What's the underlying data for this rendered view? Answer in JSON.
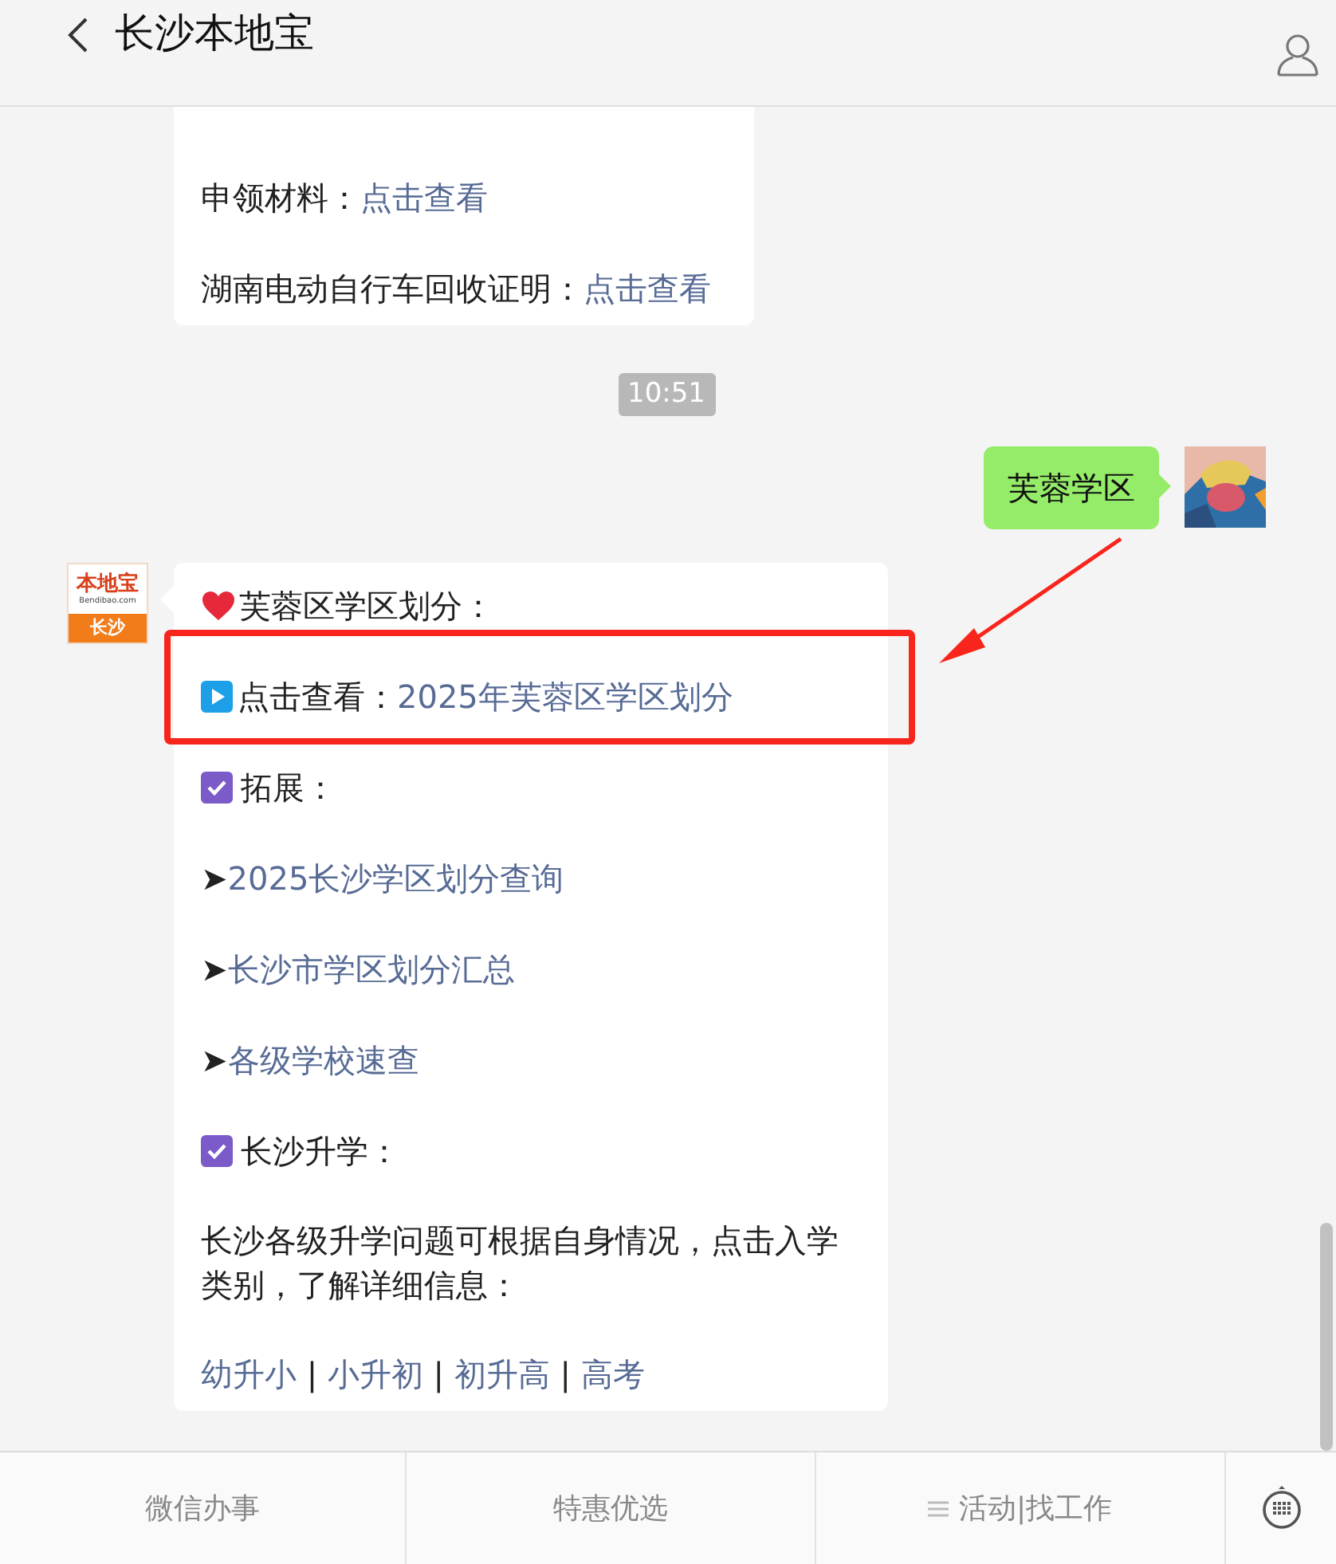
{
  "header": {
    "title": "长沙本地宝"
  },
  "messages": [
    {
      "kind": "bot_card",
      "lines": [
        {
          "kind": "plain",
          "parts": [
            {
              "text": "申领材料：",
              "link": false
            },
            {
              "text": "点击查看",
              "link": true
            }
          ]
        },
        {
          "kind": "plain",
          "parts": [
            {
              "text": "湖南电动自行车回收证明：",
              "link": false
            },
            {
              "text": "点击查看",
              "link": true
            }
          ]
        }
      ]
    },
    {
      "kind": "timestamp",
      "text": "10:51"
    },
    {
      "kind": "user_text",
      "text": "芙蓉学区"
    },
    {
      "kind": "bot_card",
      "avatar": {
        "logo": "本地宝",
        "site": "Bendibao.com",
        "city": "长沙"
      },
      "lines": [
        {
          "kind": "heart",
          "parts": [
            {
              "text": "芙蓉区学区划分：",
              "link": false
            }
          ]
        },
        {
          "kind": "play",
          "highlighted": true,
          "parts": [
            {
              "text": "点击查看：",
              "link": false
            },
            {
              "text": "2025年芙蓉区学区划分",
              "link": true
            }
          ]
        },
        {
          "kind": "check",
          "parts": [
            {
              "text": "拓展：",
              "link": false
            }
          ]
        },
        {
          "kind": "plain",
          "parts": [
            {
              "text": "➤",
              "link": false
            },
            {
              "text": "2025长沙学区划分查询",
              "link": true
            }
          ]
        },
        {
          "kind": "plain",
          "parts": [
            {
              "text": "➤",
              "link": false
            },
            {
              "text": "长沙市学区划分汇总",
              "link": true
            }
          ]
        },
        {
          "kind": "plain",
          "parts": [
            {
              "text": "➤",
              "link": false
            },
            {
              "text": "各级学校速查",
              "link": true
            }
          ]
        },
        {
          "kind": "check",
          "parts": [
            {
              "text": "长沙升学：",
              "link": false
            }
          ]
        },
        {
          "kind": "paragraph",
          "parts": [
            {
              "text": "长沙各级升学问题可根据自身情况，点击入学类别，了解详细信息：",
              "link": false
            }
          ]
        },
        {
          "kind": "plain",
          "parts": [
            {
              "text": "幼升小",
              "link": true
            },
            {
              "text": " | ",
              "link": false
            },
            {
              "text": "小升初",
              "link": true
            },
            {
              "text": " | ",
              "link": false
            },
            {
              "text": "初升高",
              "link": true
            },
            {
              "text": " | ",
              "link": false
            },
            {
              "text": "高考",
              "link": true
            }
          ]
        }
      ]
    }
  ],
  "menu": [
    {
      "label": "微信办事",
      "has_submenu": false
    },
    {
      "label": "特惠优选",
      "has_submenu": false
    },
    {
      "label": "活动|找工作",
      "has_submenu": true
    }
  ]
}
